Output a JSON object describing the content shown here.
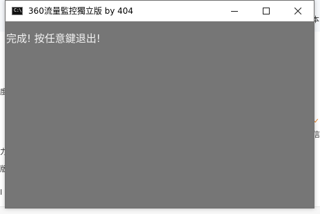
{
  "background_app": {
    "top_right_char": "本",
    "check_mark": "✓",
    "right_char": "信",
    "left_chars": [
      "度",
      "力",
      "版",
      "I"
    ],
    "caret": "⌃"
  },
  "console_window": {
    "title": "360流量監控獨立版 by 404",
    "icon": "cmd-console-icon",
    "icon_glyph": "C:\\",
    "buttons": {
      "minimize": "minimize-icon",
      "maximize": "maximize-icon",
      "close": "close-icon"
    },
    "output_text": "完成! 按任意鍵退出!",
    "colors": {
      "body_background": "#767676",
      "text": "#f2f2f2",
      "titlebar": "#ffffff"
    }
  }
}
